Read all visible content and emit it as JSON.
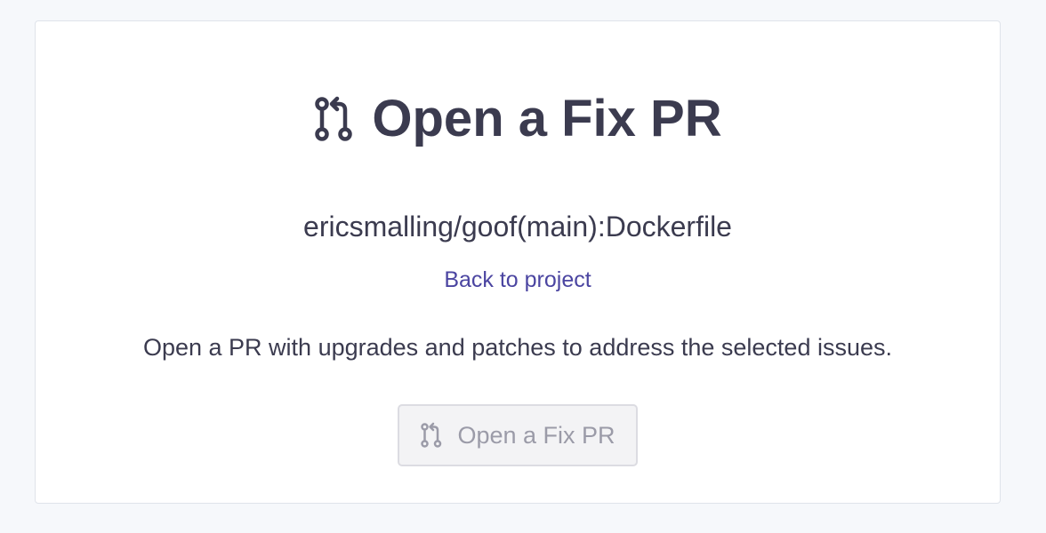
{
  "header": {
    "title": "Open a Fix PR",
    "title_icon": "pull-request-icon"
  },
  "project": {
    "name": "ericsmalling/goof(main):Dockerfile",
    "back_link": "Back to project"
  },
  "description": "Open a PR with upgrades and patches to address the selected issues.",
  "action": {
    "button_label": "Open a Fix PR",
    "button_icon": "pull-request-icon",
    "disabled": true
  },
  "colors": {
    "text": "#3b3b4f",
    "link": "#4b45a1",
    "button_text_disabled": "#9b9ba8",
    "page_background": "#f6f8fb"
  }
}
